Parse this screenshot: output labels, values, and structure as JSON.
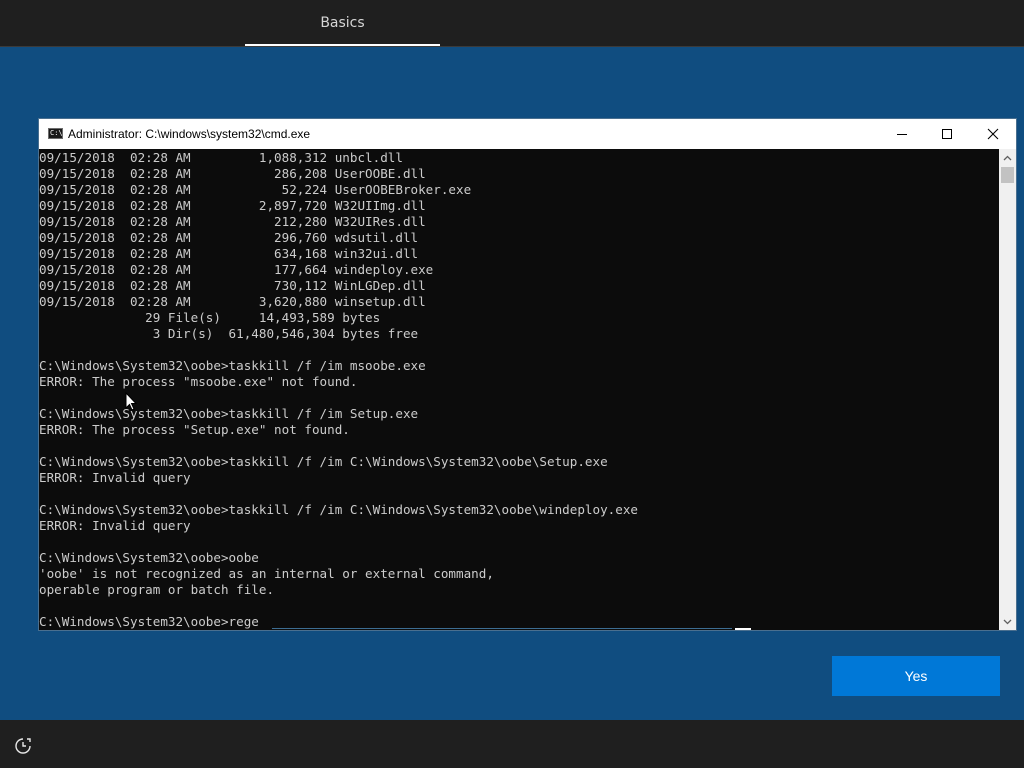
{
  "header": {
    "tab_label": "Basics"
  },
  "cmd": {
    "title": "Administrator: C:\\windows\\system32\\cmd.exe",
    "icon_label": "C:\\",
    "icon": "console-icon",
    "lines": [
      "09/15/2018  02:28 AM         1,088,312 unbcl.dll",
      "09/15/2018  02:28 AM           286,208 UserOOBE.dll",
      "09/15/2018  02:28 AM            52,224 UserOOBEBroker.exe",
      "09/15/2018  02:28 AM         2,897,720 W32UIImg.dll",
      "09/15/2018  02:28 AM           212,280 W32UIRes.dll",
      "09/15/2018  02:28 AM           296,760 wdsutil.dll",
      "09/15/2018  02:28 AM           634,168 win32ui.dll",
      "09/15/2018  02:28 AM           177,664 windeploy.exe",
      "09/15/2018  02:28 AM           730,112 WinLGDep.dll",
      "09/15/2018  02:28 AM         3,620,880 winsetup.dll",
      "              29 File(s)     14,493,589 bytes",
      "               3 Dir(s)  61,480,546,304 bytes free",
      "",
      "C:\\Windows\\System32\\oobe>taskkill /f /im msoobe.exe",
      "ERROR: The process \"msoobe.exe\" not found.",
      "",
      "C:\\Windows\\System32\\oobe>taskkill /f /im Setup.exe",
      "ERROR: The process \"Setup.exe\" not found.",
      "",
      "C:\\Windows\\System32\\oobe>taskkill /f /im C:\\Windows\\System32\\oobe\\Setup.exe",
      "ERROR: Invalid query",
      "",
      "C:\\Windows\\System32\\oobe>taskkill /f /im C:\\Windows\\System32\\oobe\\windeploy.exe",
      "ERROR: Invalid query",
      "",
      "C:\\Windows\\System32\\oobe>oobe",
      "'oobe' is not recognized as an internal or external command,",
      "operable program or batch file.",
      "",
      "C:\\Windows\\System32\\oobe>rege"
    ],
    "window_buttons": {
      "minimize": "minimize-icon",
      "maximize": "maximize-icon",
      "close": "close-icon"
    }
  },
  "actions": {
    "yes_label": "Yes"
  },
  "footer": {
    "ease_of_access_icon": "ease-of-access-icon"
  },
  "colors": {
    "background": "#104d80",
    "bar": "#1f1f1f",
    "console_bg": "#0c0c0c",
    "console_text": "#cccccc",
    "accent": "#0078d7"
  }
}
